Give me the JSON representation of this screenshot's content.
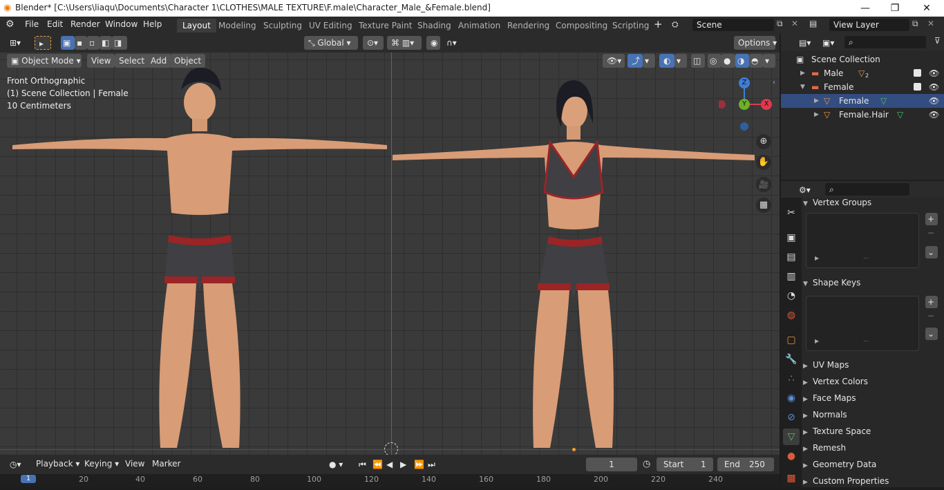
{
  "window": {
    "title": "Blender* [C:\\Users\\liaqu\\Documents\\Character 1\\CLOTHES\\MALE TEXTURE\\F.male\\Character_Male_&Female.blend]",
    "minimize": "—",
    "maximize": "❐",
    "close": "✕"
  },
  "menu": [
    "File",
    "Edit",
    "Render",
    "Window",
    "Help"
  ],
  "workspaces": [
    "Layout",
    "Modeling",
    "Sculpting",
    "UV Editing",
    "Texture Paint",
    "Shading",
    "Animation",
    "Rendering",
    "Compositing",
    "Scripting"
  ],
  "workspace_add": "+",
  "scene": {
    "label": "Scene",
    "view_layer": "View Layer"
  },
  "viewport": {
    "mode": "Object Mode",
    "menus": [
      "View",
      "Select",
      "Add",
      "Object"
    ],
    "transform": "Global",
    "options": "Options",
    "info": [
      "Front Orthographic",
      "(1) Scene Collection | Female",
      "10 Centimeters"
    ],
    "gizmo": {
      "z": "Z",
      "y": "Y",
      "x": "X"
    }
  },
  "outliner": {
    "root": "Scene Collection",
    "rows": [
      {
        "label": "Male",
        "badge": "2"
      },
      {
        "label": "Female"
      },
      {
        "label": "Female"
      },
      {
        "label": "Female.Hair"
      }
    ]
  },
  "properties": {
    "panels": [
      "Vertex Groups",
      "Shape Keys",
      "UV Maps",
      "Vertex Colors",
      "Face Maps",
      "Normals",
      "Texture Space",
      "Remesh",
      "Geometry Data",
      "Custom Properties"
    ]
  },
  "timeline": {
    "menus": [
      "Playback",
      "Keying",
      "View",
      "Marker"
    ],
    "current_frame": "1",
    "start_label": "Start",
    "start": "1",
    "end_label": "End",
    "end": "250",
    "ruler": [
      "1",
      "20",
      "40",
      "60",
      "80",
      "100",
      "120",
      "140",
      "160",
      "180",
      "200",
      "220",
      "240"
    ]
  },
  "colors": {
    "accent": "#4772b3",
    "active_tab": "#3d3d3d",
    "axis_x": "#e0394d",
    "axis_y": "#6db02a",
    "axis_z": "#3d7fd8",
    "collection": "#e06b45"
  }
}
